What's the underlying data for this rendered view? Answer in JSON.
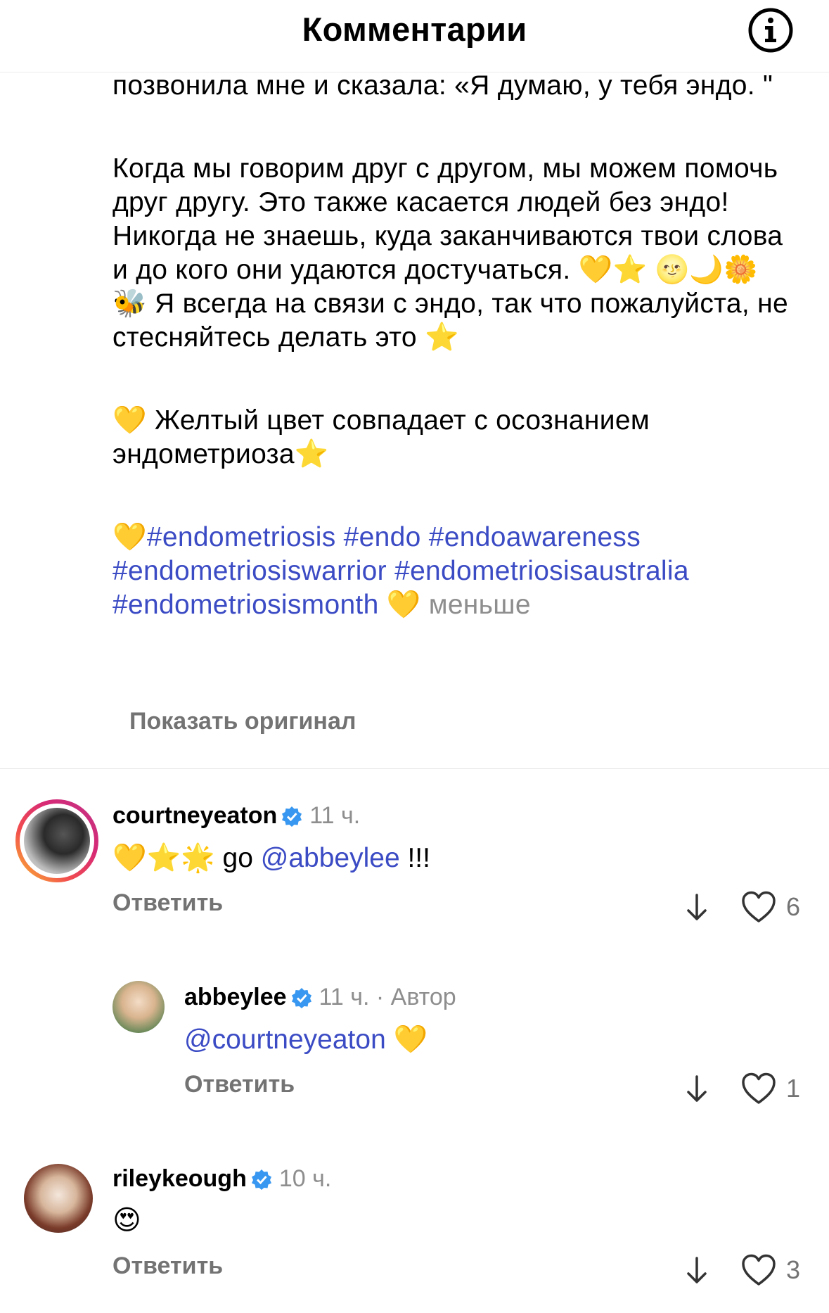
{
  "header": {
    "title": "Комментарии"
  },
  "caption": {
    "p1": "позвонила мне и сказала: «Я думаю, у тебя эндо. \"",
    "p2": "Когда мы говорим друг с другом, мы можем помочь друг другу. Это также касается людей без эндо! Никогда не знаешь, куда заканчиваются твои слова и до кого они удаются достучаться. 💛⭐ 🌝🌙🌼 🐝 Я всегда на связи с эндо, так что пожалуйста, не стесняйтесь делать это ⭐",
    "p3": "💛 Желтый цвет совпадает с осознанием эндометриоза⭐",
    "p4_emoji": " 💛",
    "hashtags": "#endometriosis #endo #endoawareness #endometriosiswarrior #endometriosisaustralia #endometriosismonth",
    "p4_end_emoji": " 💛 ",
    "less_label": "меньше",
    "show_original": "Показать оригинал"
  },
  "comments": [
    {
      "username": "courtneyeaton",
      "time": "11 ч.",
      "text_prefix": "💛⭐🌟 go ",
      "mention": "@abbeylee",
      "text_suffix": " !!!",
      "reply_label": "Ответить",
      "likes": "6",
      "has_story_ring": true
    },
    {
      "username": "abbeylee",
      "time": "11 ч. · Автор",
      "text_prefix": "",
      "mention": "@courtneyeaton",
      "text_suffix": " 💛",
      "reply_label": "Ответить",
      "likes": "1"
    },
    {
      "username": "rileykeough",
      "time": "10 ч.",
      "text_prefix": "😍",
      "mention": "",
      "text_suffix": "",
      "reply_label": "Ответить",
      "likes": "3"
    }
  ],
  "icons": {
    "info": "info-icon",
    "verified": "verified-badge-icon",
    "translate": "down-arrow-icon",
    "like": "heart-outline-icon"
  },
  "colors": {
    "link": "#3b4bc4",
    "muted": "#8e8e8e",
    "verified": "#3897f0"
  }
}
